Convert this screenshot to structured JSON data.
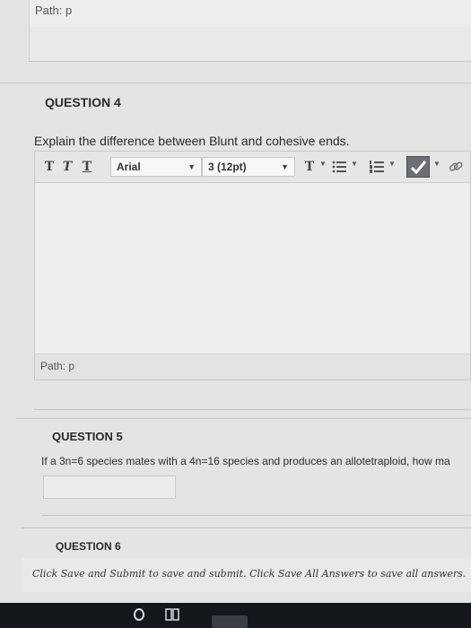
{
  "previous": {
    "path_label": "Path: p"
  },
  "question4": {
    "title": "QUESTION 4",
    "text": "Explain the difference between Blunt and cohesive ends.",
    "editor": {
      "format_buttons": [
        "T",
        "T",
        "T"
      ],
      "font_family": "Arial",
      "font_size": "3 (12pt)",
      "path_label": "Path: p"
    }
  },
  "question5": {
    "title": "QUESTION 5",
    "text": "If a 3n=6 species mates with a 4n=16 species and produces an allotetraploid, how ma",
    "answer_value": ""
  },
  "question6": {
    "title": "QUESTION 6"
  },
  "footer": {
    "note": "Click Save and Submit to save and submit. Click Save All Answers to save all answers."
  },
  "colors": {
    "background": "#e4e4e4",
    "taskbar": "#14171c"
  },
  "icons": [
    "text-color-icon",
    "bullet-list-icon",
    "numbered-list-icon",
    "spellcheck-icon",
    "link-icon",
    "search-icon",
    "task-view-icon"
  ]
}
